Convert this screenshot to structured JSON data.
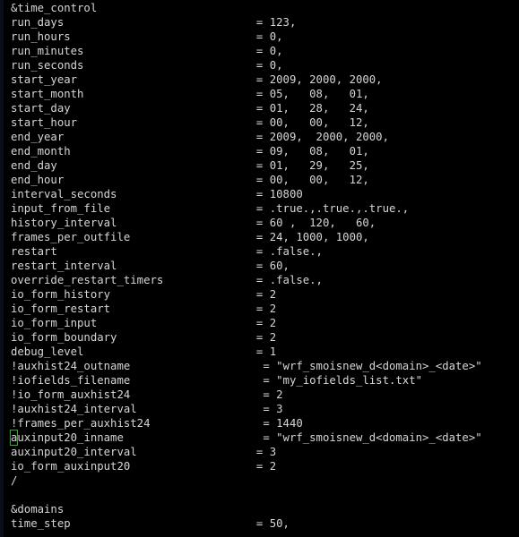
{
  "terminal": {
    "background_color": "#000000",
    "text_color": "#d6d6d6",
    "cursor_color": "#2fa82f",
    "left_gutter_color": "#0a0e1a",
    "cursor": {
      "line_index": 30,
      "column": 0,
      "character": "a",
      "style": "hollow-box"
    }
  },
  "file": {
    "format": "fortran-namelist",
    "lines": [
      {
        "name": "&time_control",
        "value": null,
        "commented": false,
        "is_header": true
      },
      {
        "name": "run_days",
        "value": "123,",
        "commented": false
      },
      {
        "name": "run_hours",
        "value": "0,",
        "commented": false
      },
      {
        "name": "run_minutes",
        "value": "0,",
        "commented": false
      },
      {
        "name": "run_seconds",
        "value": "0,",
        "commented": false
      },
      {
        "name": "start_year",
        "value": "2009, 2000, 2000,",
        "commented": false
      },
      {
        "name": "start_month",
        "value": "05,   08,   01,",
        "commented": false
      },
      {
        "name": "start_day",
        "value": "01,   28,   24,",
        "commented": false
      },
      {
        "name": "start_hour",
        "value": "00,   00,   12,",
        "commented": false
      },
      {
        "name": "end_year",
        "value": "2009,  2000, 2000,",
        "commented": false
      },
      {
        "name": "end_month",
        "value": "09,   08,   01,",
        "commented": false
      },
      {
        "name": "end_day",
        "value": "01,   29,   25,",
        "commented": false
      },
      {
        "name": "end_hour",
        "value": "00,   00,   12,",
        "commented": false
      },
      {
        "name": "interval_seconds",
        "value": "10800",
        "commented": false
      },
      {
        "name": "input_from_file",
        "value": ".true.,.true.,.true.,",
        "commented": false
      },
      {
        "name": "history_interval",
        "value": "60 ,  120,   60,",
        "commented": false
      },
      {
        "name": "frames_per_outfile",
        "value": "24, 1000, 1000,",
        "commented": false
      },
      {
        "name": "restart",
        "value": ".false.,",
        "commented": false
      },
      {
        "name": "restart_interval",
        "value": "60,",
        "commented": false
      },
      {
        "name": "override_restart_timers",
        "value": ".false.,",
        "commented": false
      },
      {
        "name": "io_form_history",
        "value": "2",
        "commented": false
      },
      {
        "name": "io_form_restart",
        "value": "2",
        "commented": false
      },
      {
        "name": "io_form_input",
        "value": "2",
        "commented": false
      },
      {
        "name": "io_form_boundary",
        "value": "2",
        "commented": false
      },
      {
        "name": "debug_level",
        "value": "1",
        "commented": false
      },
      {
        "name": "!auxhist24_outname",
        "value": "\"wrf_smoisnew_d<domain>_<date>\"",
        "commented": true
      },
      {
        "name": "!iofields_filename",
        "value": "\"my_iofields_list.txt\"",
        "commented": true
      },
      {
        "name": "!io_form_auxhist24",
        "value": "2",
        "commented": true
      },
      {
        "name": "!auxhist24_interval",
        "value": "3",
        "commented": true
      },
      {
        "name": "!frames_per_auxhist24",
        "value": "1440",
        "commented": true
      },
      {
        "name": "auxinput20_inname",
        "value": "\"wrf_smoisnew_d<domain>_<date>\"",
        "commented": true
      },
      {
        "name": "auxinput20_interval",
        "value": "3",
        "commented": false
      },
      {
        "name": "io_form_auxinput20",
        "value": "2",
        "commented": false
      },
      {
        "name": "/",
        "value": null,
        "commented": false,
        "is_header": true
      },
      {
        "name": "",
        "value": null,
        "commented": false,
        "is_blank": true
      },
      {
        "name": "&domains",
        "value": null,
        "commented": false,
        "is_header": true
      },
      {
        "name": "time_step",
        "value": "50,",
        "commented": false
      }
    ]
  }
}
